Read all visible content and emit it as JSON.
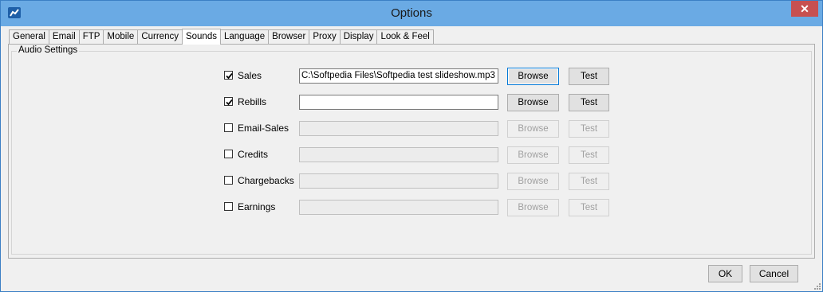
{
  "window": {
    "title": "Options",
    "close_label": "✕"
  },
  "tabs": [
    "General",
    "Email",
    "FTP",
    "Mobile",
    "Currency",
    "Sounds",
    "Language",
    "Browser",
    "Proxy",
    "Display",
    "Look & Feel"
  ],
  "active_tab": "Sounds",
  "group_title": "Audio Settings",
  "sounds": [
    {
      "label": "Sales",
      "checked": true,
      "path": "C:\\Softpedia Files\\Softpedia test slideshow.mp3",
      "enabled": true,
      "browse": "Browse",
      "test": "Test"
    },
    {
      "label": "Rebills",
      "checked": true,
      "path": "",
      "enabled": true,
      "browse": "Browse",
      "test": "Test"
    },
    {
      "label": "Email-Sales",
      "checked": false,
      "path": "",
      "enabled": false,
      "browse": "Browse",
      "test": "Test"
    },
    {
      "label": "Credits",
      "checked": false,
      "path": "",
      "enabled": false,
      "browse": "Browse",
      "test": "Test"
    },
    {
      "label": "Chargebacks",
      "checked": false,
      "path": "",
      "enabled": false,
      "browse": "Browse",
      "test": "Test"
    },
    {
      "label": "Earnings",
      "checked": false,
      "path": "",
      "enabled": false,
      "browse": "Browse",
      "test": "Test"
    }
  ],
  "footer": {
    "ok_label": "OK",
    "cancel_label": "Cancel"
  },
  "colors": {
    "titlebar": "#6aaae4",
    "close": "#c75050",
    "focus": "#0078d7"
  }
}
